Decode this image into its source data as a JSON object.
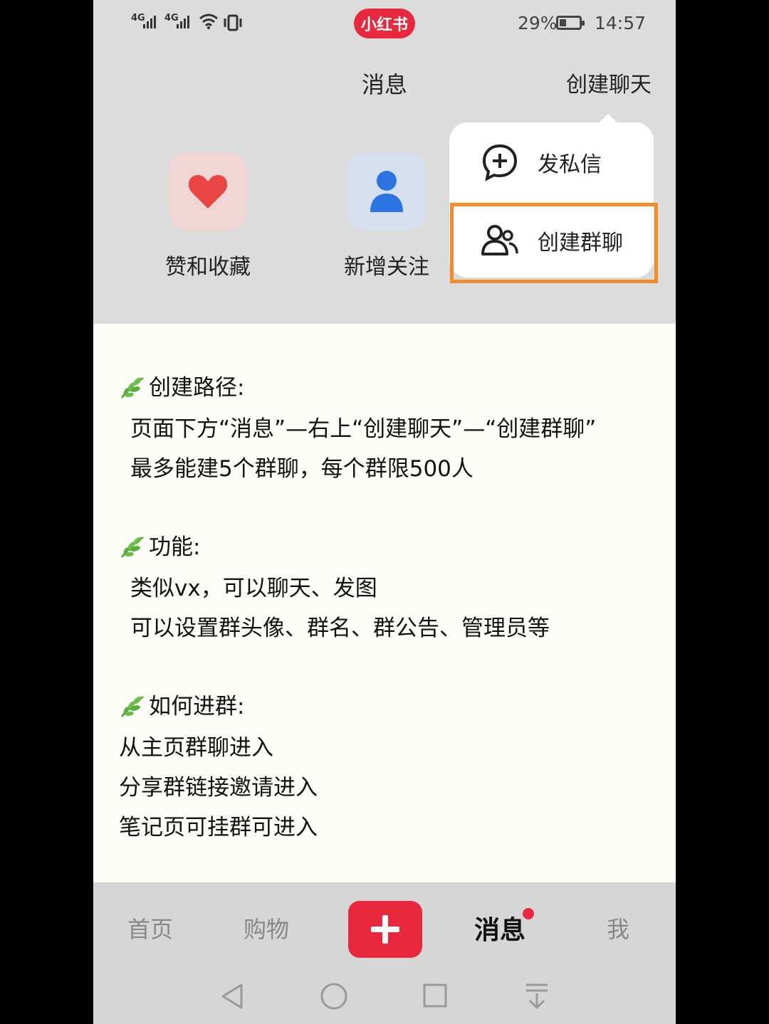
{
  "status_bar": {
    "signal1": "4G",
    "signal2": "4G",
    "app_badge": "小红书",
    "battery_percent": "29%",
    "battery_level": 0.29,
    "time": "14:57"
  },
  "header": {
    "title": "消息",
    "create_chat_label": "创建聊天"
  },
  "shortcuts": [
    {
      "label": "赞和收藏",
      "icon": "heart-icon",
      "bg": "#f3d7d7",
      "color": "#e84545"
    },
    {
      "label": "新增关注",
      "icon": "person-icon",
      "bg": "#d7e1ef",
      "color": "#2b74e2"
    }
  ],
  "dropdown": {
    "items": [
      {
        "label": "发私信",
        "icon": "chat-plus-icon"
      },
      {
        "label": "创建群聊",
        "icon": "group-icon"
      }
    ],
    "highlight_color": "#f28c2a"
  },
  "content": {
    "section1_heading": "创建路径:",
    "section1_line1": "页面下方“消息”—右上“创建聊天”—“创建群聊”",
    "section1_line2": "最多能建5个群聊，每个群限500人",
    "section2_heading": "功能:",
    "section2_line1": "类似vx，可以聊天、发图",
    "section2_line2": "可以设置群头像、群名、群公告、管理员等",
    "section3_heading": "如何进群:",
    "section3_line1": "从主页群聊进入",
    "section3_line2": "分享群链接邀请进入",
    "section3_line3": "笔记页可挂群可进入"
  },
  "tabbar": {
    "home": "首页",
    "shop": "购物",
    "messages": "消息",
    "me": "我",
    "accent": "#e8283c"
  },
  "navbar": {
    "back": "back-icon",
    "home": "home-circle-icon",
    "recents": "recents-square-icon",
    "notifications": "pull-down-icon"
  }
}
